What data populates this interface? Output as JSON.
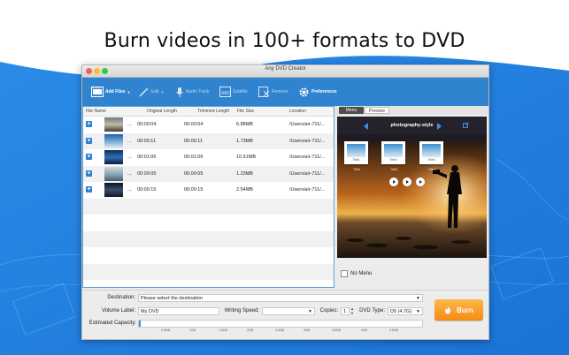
{
  "headline": "Burn videos in 100+ formats to DVD",
  "window": {
    "title": "Any DVD Creator"
  },
  "toolbar": {
    "add_files": "Add Files",
    "edit": "Edit",
    "audio_track": "Audio Track",
    "subtitle": "Subtitle",
    "remove": "Remove",
    "preferences": "Preferences"
  },
  "file_list": {
    "columns": [
      "File Name",
      "Original Length",
      "Trimmed Length",
      "File Size",
      "Location"
    ],
    "rows": [
      {
        "name": "...",
        "original": "00:00:04",
        "trimmed": "00:00:04",
        "size": "6.88MB",
        "location": "/Users/air-711/..."
      },
      {
        "name": "...",
        "original": "00:00:11",
        "trimmed": "00:00:11",
        "size": "1.73MB",
        "location": "/Users/air-711/..."
      },
      {
        "name": "...",
        "original": "00:01:06",
        "trimmed": "00:01:06",
        "size": "10.51MB",
        "location": "/Users/air-711/..."
      },
      {
        "name": "...",
        "original": "00:00:05",
        "trimmed": "00:00:05",
        "size": "1.23MB",
        "location": "/Users/air-711/..."
      },
      {
        "name": "...",
        "original": "00:00:15",
        "trimmed": "00:00:15",
        "size": "2.54MB",
        "location": "/Users/air-711/..."
      }
    ]
  },
  "preview": {
    "tab_menu": "Menu",
    "tab_preview": "Preview",
    "template_name": "photography-style",
    "card_titles": [
      "Title1",
      "Title2",
      "Title3"
    ],
    "no_menu_label": "No Menu",
    "no_menu_checked": false
  },
  "settings": {
    "destination_label": "Destination:",
    "destination_placeholder": "Please select the destination",
    "volume_label_label": "Volume Label:",
    "volume_label_value": "My DVD",
    "writing_speed_label": "Writing Speed:",
    "writing_speed_value": "",
    "copies_label": "Copies:",
    "copies_value": "1",
    "dvd_type_label": "DVD Type:",
    "dvd_type_value": "D5 (4.7G)",
    "capacity_label": "Estimated Capacity:",
    "capacity_used_fraction": 0.005,
    "capacity_ticks": [
      "0.5GB",
      "1GB",
      "1.5GB",
      "2GB",
      "2.5GB",
      "3GB",
      "3.5GB",
      "4GB",
      "4.5GB"
    ]
  },
  "burn_button": "Burn",
  "colors": {
    "toolbar": "#2f83cf",
    "burn": "#f7a02d",
    "accent": "#3b8fe6"
  }
}
